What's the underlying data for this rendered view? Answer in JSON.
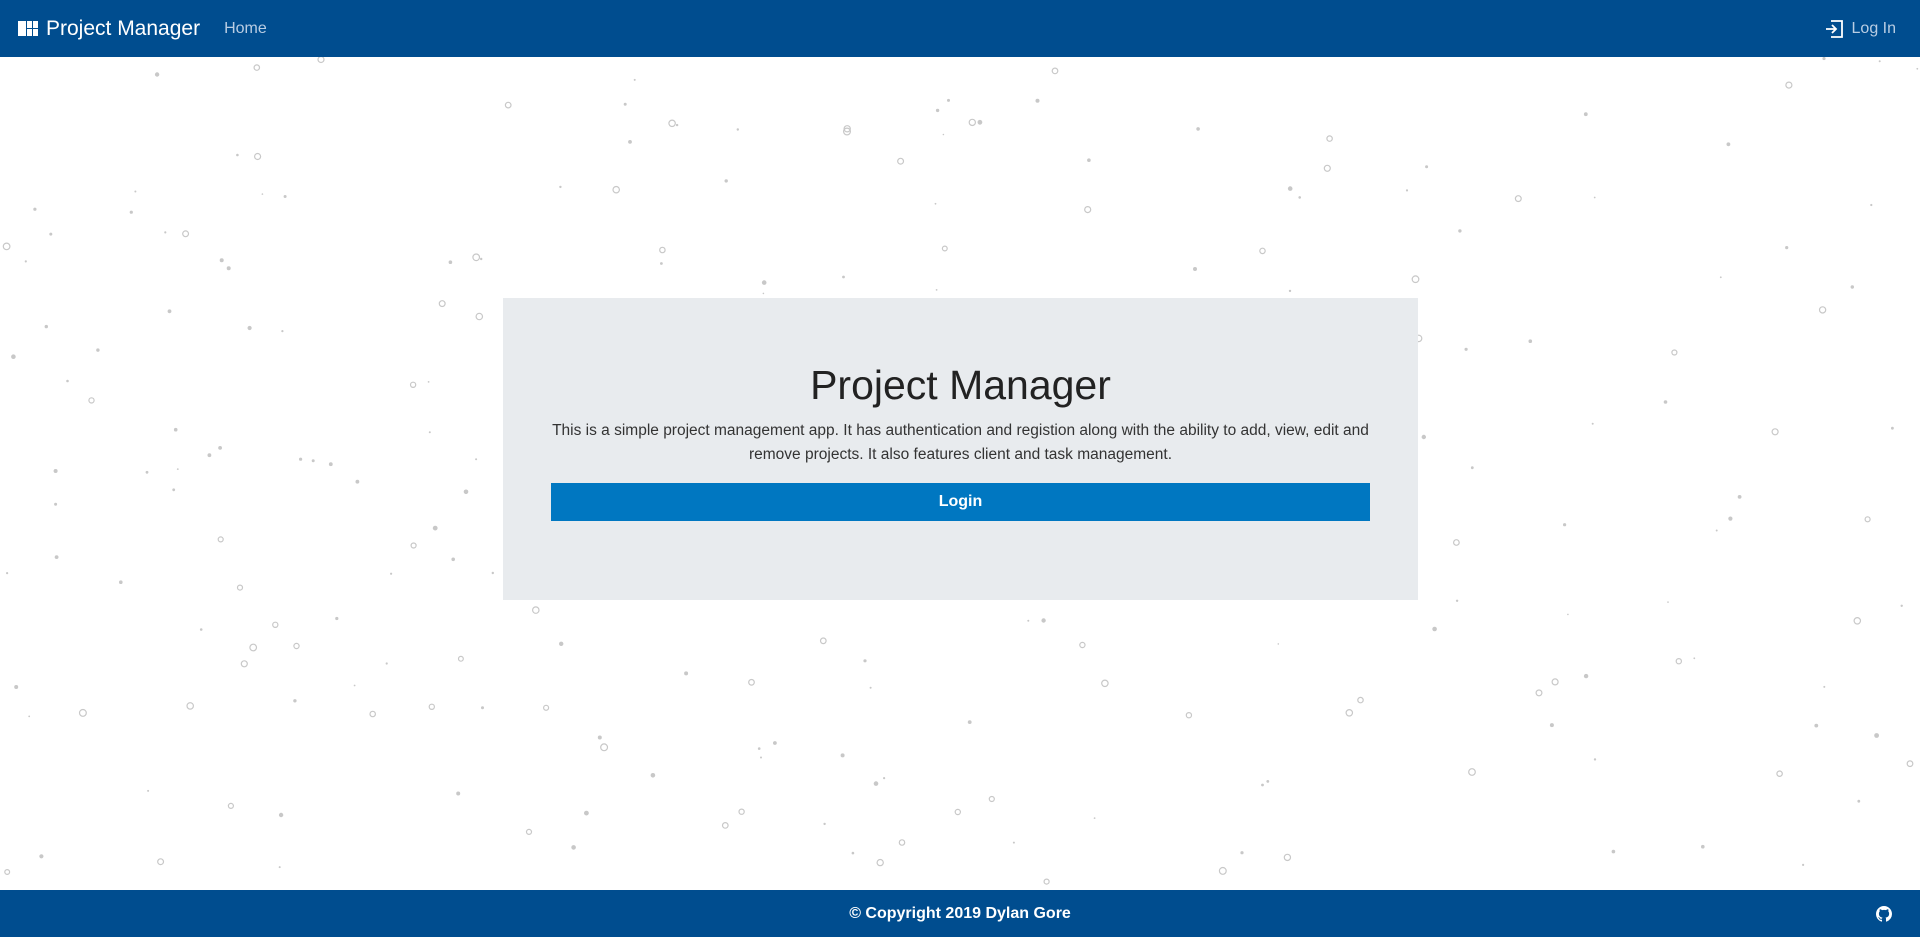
{
  "navbar": {
    "brand": "Project Manager",
    "home_label": "Home",
    "login_label": "Log In"
  },
  "jumbotron": {
    "title": "Project Manager",
    "description": "This is a simple project management app. It has authentication and registion along with the ability to add, view, edit and remove projects. It also features client and task management.",
    "button_label": "Login"
  },
  "footer": {
    "copyright": "© Copyright 2019 Dylan Gore"
  },
  "colors": {
    "primary": "#004d8f",
    "button": "#0077c1",
    "panel": "#e8ebee",
    "particle": "#c8c8c8"
  },
  "icons": {
    "brand": "dashboard-icon",
    "login": "sign-in-icon",
    "footer": "github-icon"
  }
}
